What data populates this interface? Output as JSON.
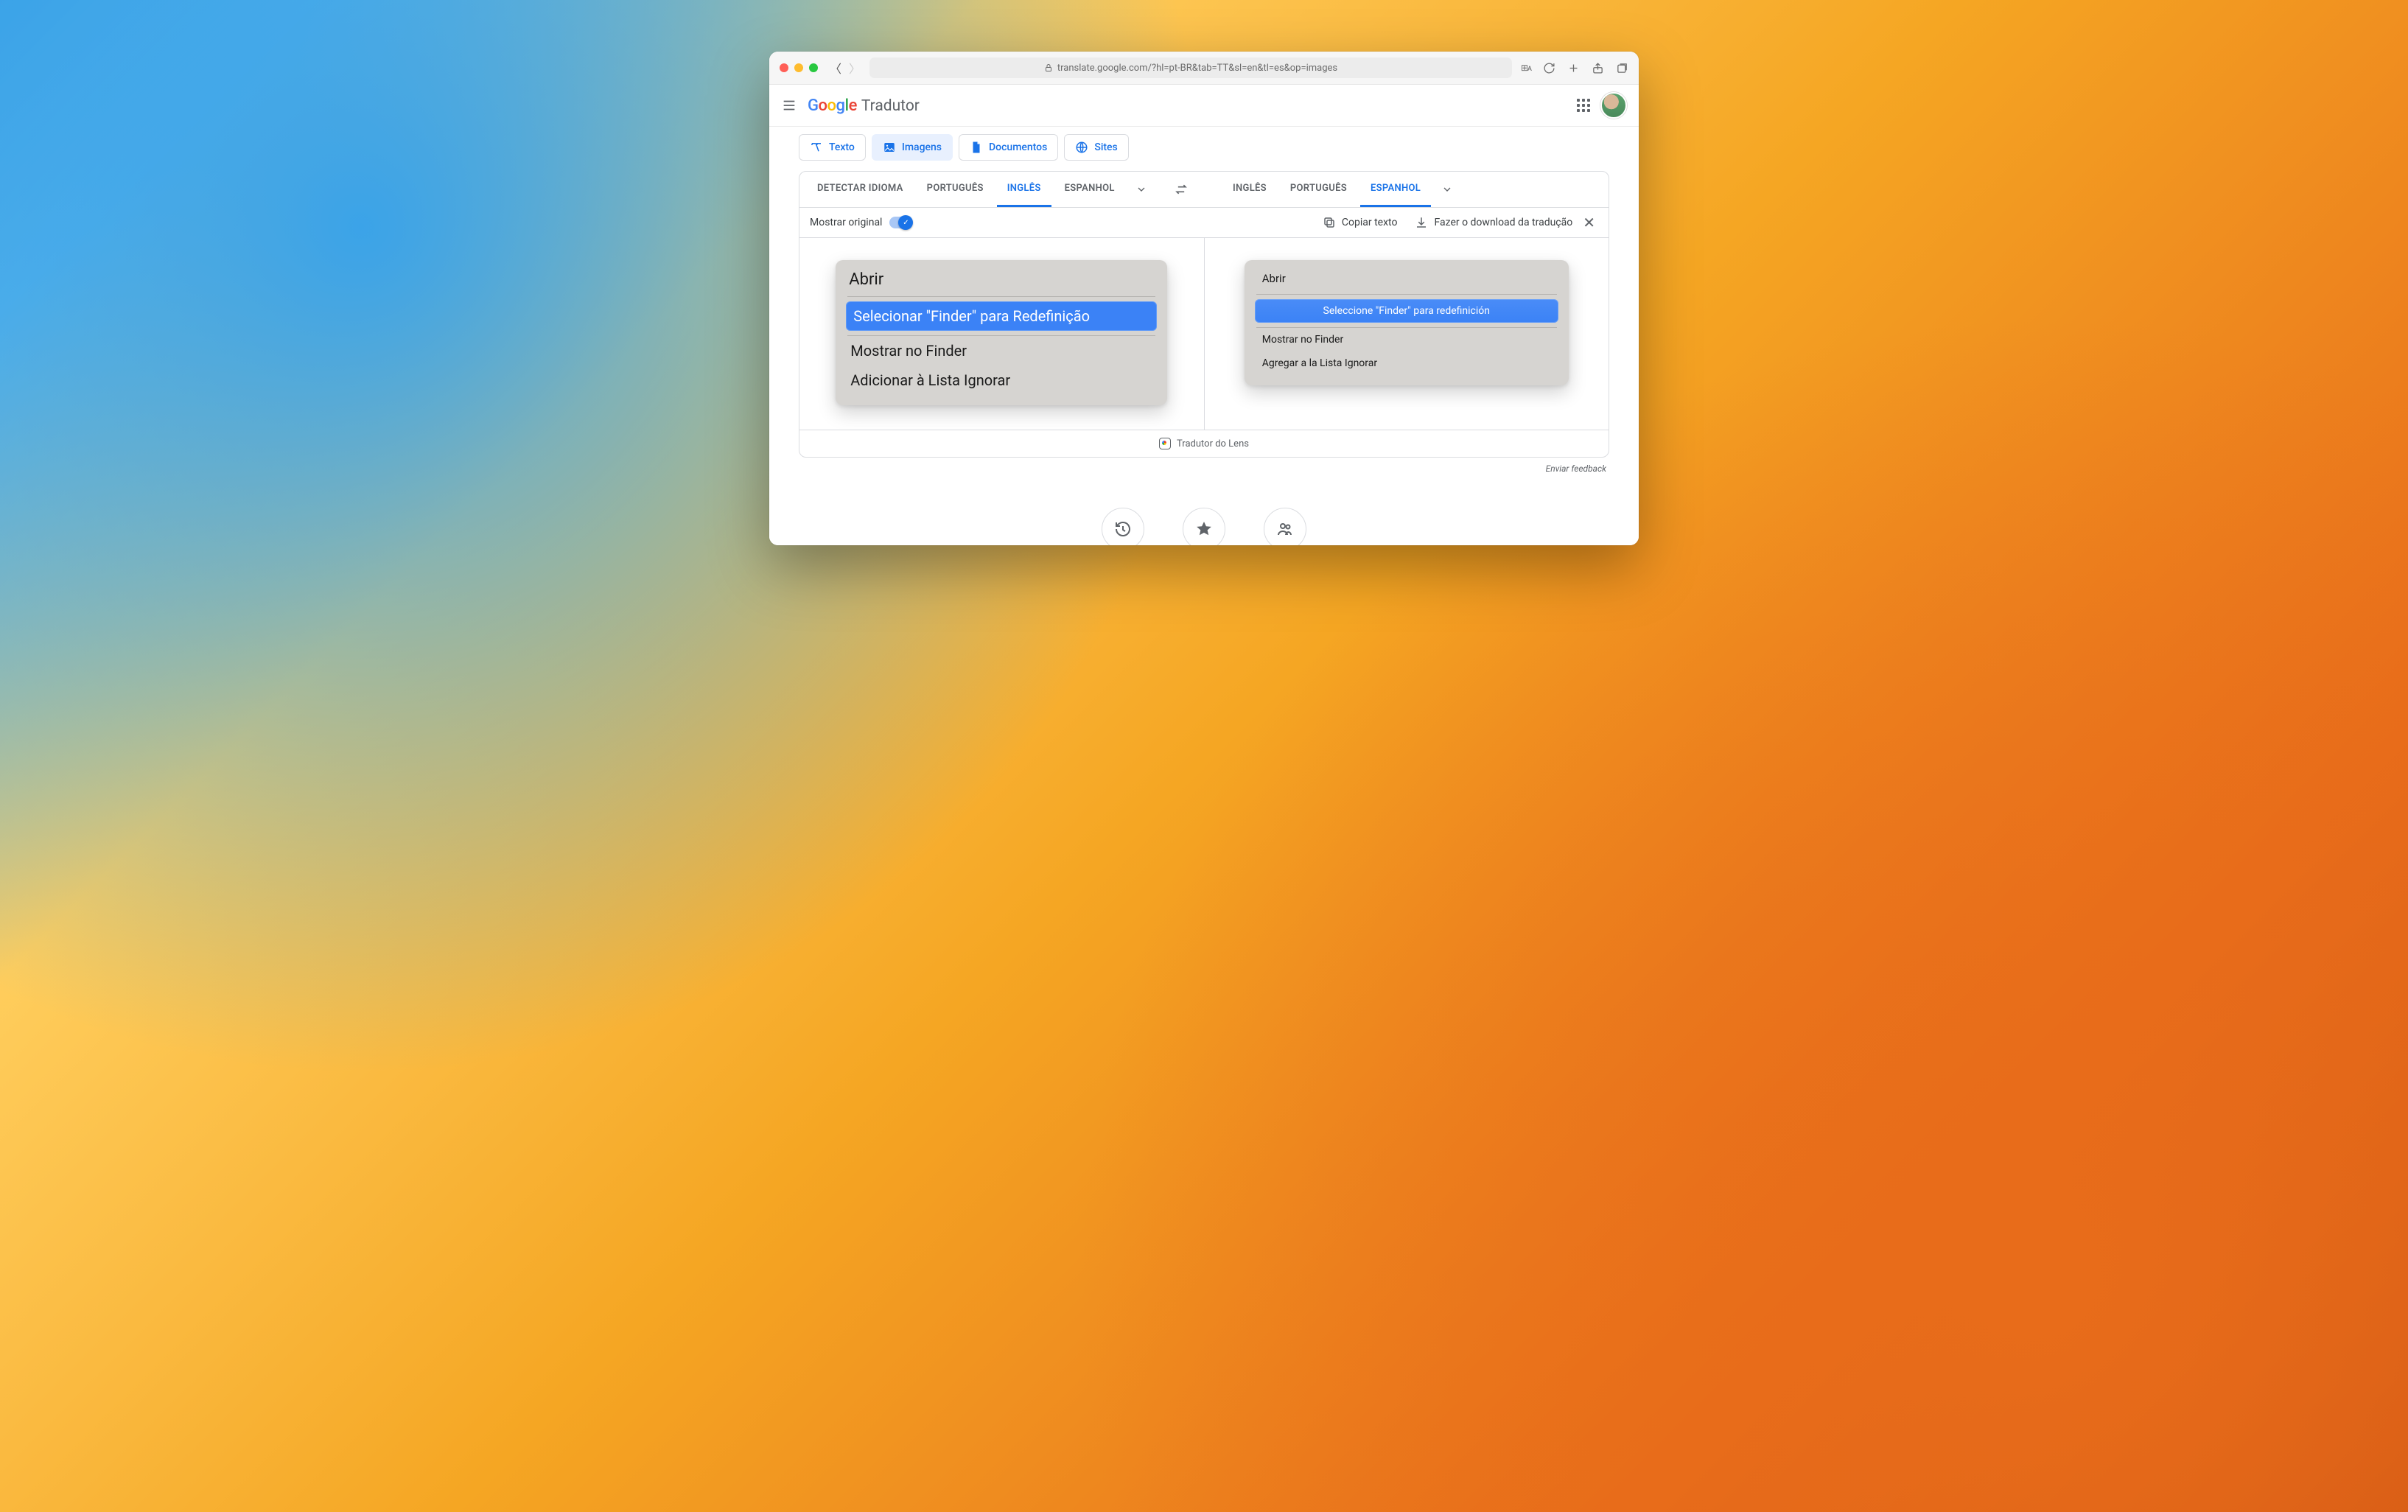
{
  "browser": {
    "url": "translate.google.com/?hl=pt-BR&tab=TT&sl=en&tl=es&op=images"
  },
  "header": {
    "product": "Tradutor"
  },
  "modes": {
    "text": "Texto",
    "images": "Imagens",
    "documents": "Documentos",
    "sites": "Sites"
  },
  "source_langs": {
    "detect": "DETECTAR IDIOMA",
    "pt": "PORTUGUÊS",
    "en": "INGLÊS",
    "es": "ESPANHOL",
    "active": "en"
  },
  "target_langs": {
    "en": "INGLÊS",
    "pt": "PORTUGUÊS",
    "es": "ESPANHOL",
    "active": "es"
  },
  "toolbar": {
    "show_original": "Mostrar original",
    "copy": "Copiar texto",
    "download": "Fazer o download da tradução"
  },
  "original_menu": {
    "title": "Abrir",
    "item_select": "Selecionar \"Finder\" para Redefinição",
    "item_show": "Mostrar no Finder",
    "item_ignore": "Adicionar à Lista Ignorar"
  },
  "translated_menu": {
    "title": "Abrir",
    "item_select": "Seleccione \"Finder\" para redefinición",
    "item_show": "Mostrar no Finder",
    "item_ignore": "Agregar a la Lista Ignorar"
  },
  "footer": {
    "lens": "Tradutor do Lens",
    "feedback": "Enviar feedback"
  }
}
